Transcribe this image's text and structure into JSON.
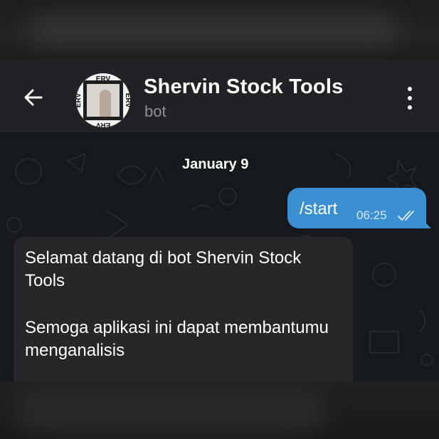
{
  "header": {
    "title": "Shervin Stock Tools",
    "subtitle": "bot",
    "avatar_text": "ERV"
  },
  "chat": {
    "date_label": "January 9",
    "messages": [
      {
        "direction": "outgoing",
        "text": "/start",
        "time": "06:25",
        "status": "read"
      },
      {
        "direction": "incoming",
        "paragraphs": [
          "Selamat datang di bot Shervin Stock Tools",
          "Semoga aplikasi ini dapat membantumu menganalisis"
        ]
      }
    ]
  },
  "icons": {
    "back": "arrow-left-icon",
    "menu": "more-vertical-icon",
    "status": "double-check-icon"
  },
  "colors": {
    "header_bg": "#212225",
    "chat_bg": "#15191d",
    "outgoing_bubble": "#3a8fd1",
    "incoming_bubble": "#262729"
  }
}
